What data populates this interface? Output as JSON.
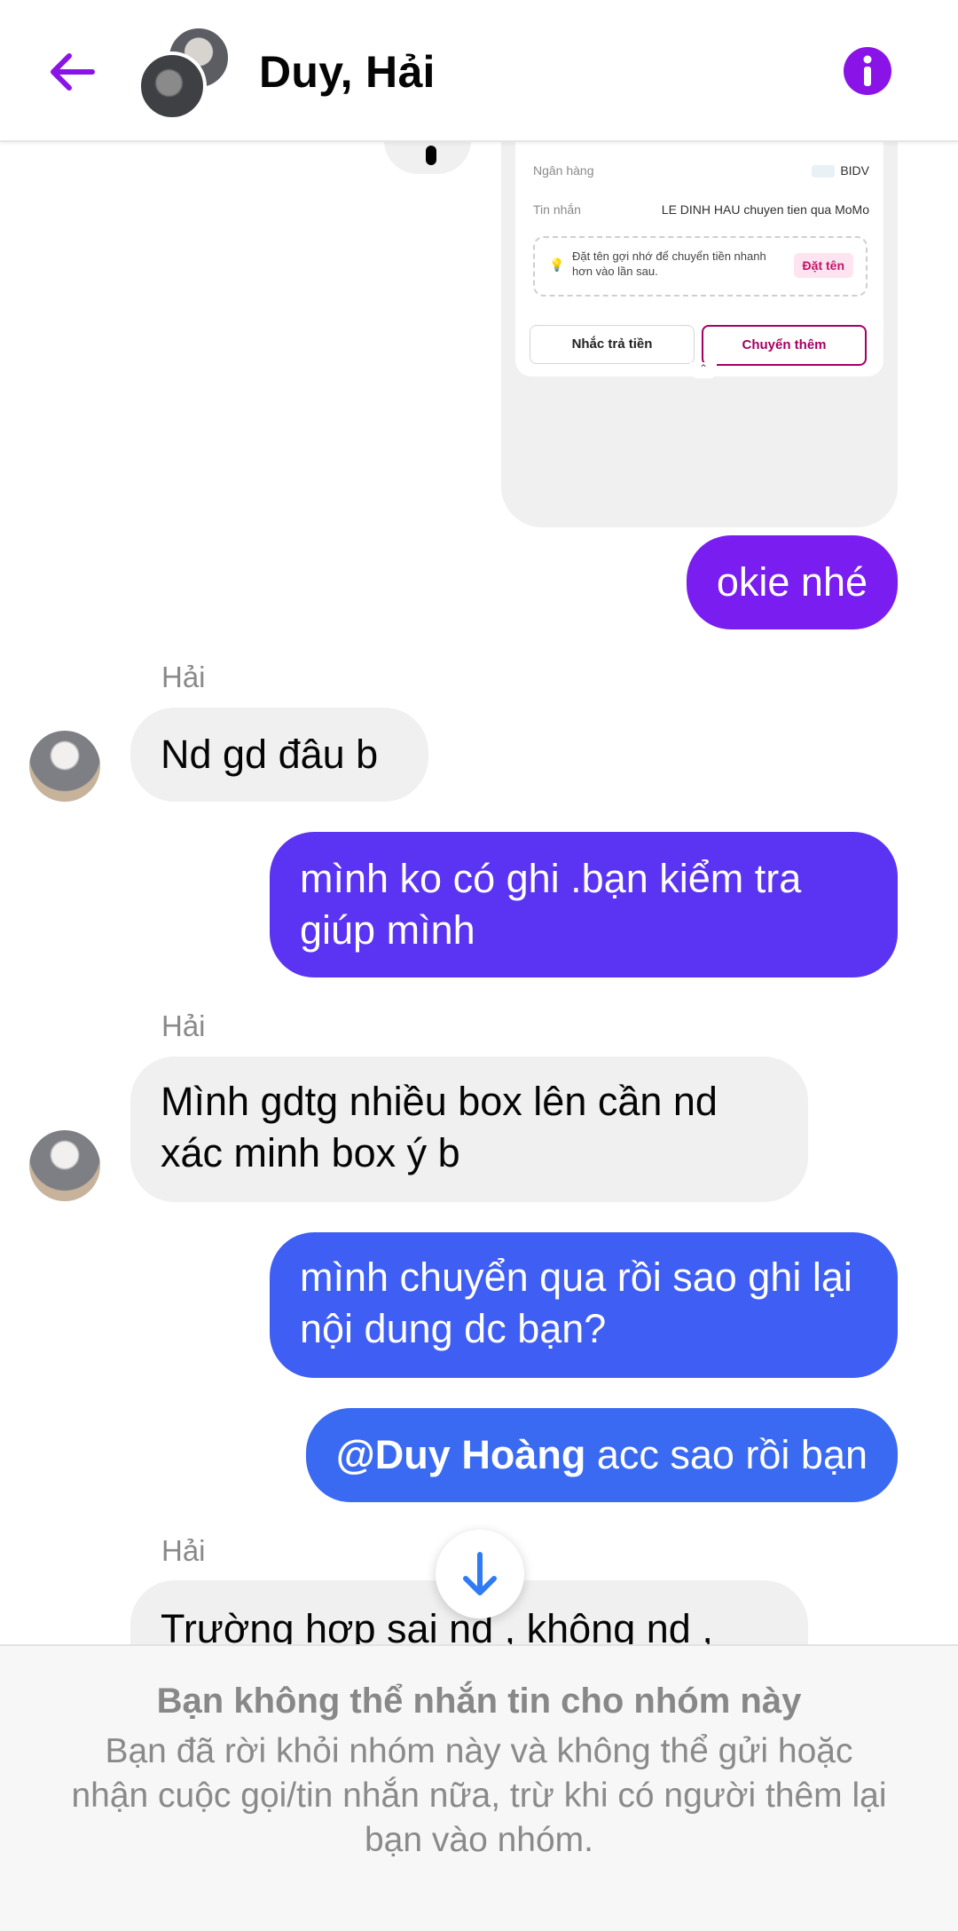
{
  "header": {
    "title": "Duy, Hải",
    "back_icon": "arrow-left-icon",
    "info_icon": "info-icon",
    "accent_color": "#8a14e8"
  },
  "transfer_card": {
    "bank_label": "Ngân hàng",
    "bank_value": "BIDV",
    "message_label": "Tin nhắn",
    "message_value": "LE DINH HAU chuyen tien qua MoMo",
    "tip_text": "Đặt tên gợi nhớ để chuyển tiền nhanh hơn vào lần sau.",
    "tip_button": "Đặt tên",
    "remind_button": "Nhắc trả tiền",
    "transfer_more_button": "Chuyển thêm",
    "caret": "⌃"
  },
  "messages": [
    {
      "from": "me",
      "text": "okie nhé",
      "color": "#7a1df0"
    },
    {
      "from": "Hải",
      "sender_label": "Hải",
      "text": "Nd gd đâu b"
    },
    {
      "from": "me",
      "text": "mình ko có ghi .bạn kiểm tra giúp mình",
      "color": "#5a34f2"
    },
    {
      "from": "Hải",
      "sender_label": "Hải",
      "text": "Mình gdtg nhiều box lên cần nd xác minh box ý b"
    },
    {
      "from": "me",
      "text": "mình chuyển qua rồi sao ghi lại nội dung dc bạn?",
      "color": "#3f5ef4"
    },
    {
      "from": "me",
      "mention": "@Duy Hoàng",
      "text": " acc sao rồi bạn",
      "color": "#3a6af2"
    },
    {
      "from": "Hải",
      "sender_label": "Hải",
      "text": "Trường hợp sai nd , không nd ,"
    }
  ],
  "jump_button_icon": "arrow-down-icon",
  "footer": {
    "title": "Bạn không thể nhắn tin cho nhóm này",
    "body": "Bạn đã rời khỏi nhóm này và không thể gửi hoặc nhận cuộc gọi/tin nhắn nữa, trừ khi có người thêm lại bạn vào nhóm."
  }
}
